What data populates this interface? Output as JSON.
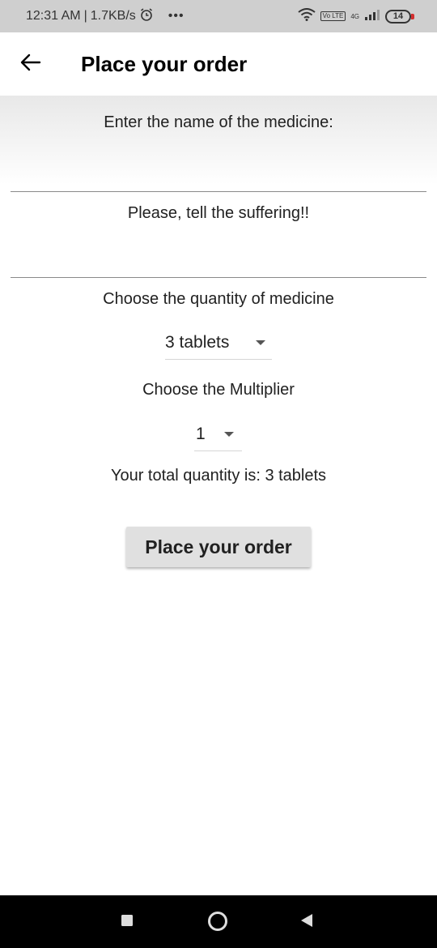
{
  "status_bar": {
    "time": "12:31 AM",
    "separator": "|",
    "speed": "1.7KB/s",
    "volte": "Vo LTE",
    "network": "4G",
    "battery": "14"
  },
  "app_bar": {
    "title": "Place your order"
  },
  "form": {
    "medicine_prompt": "Enter the name of the medicine:",
    "medicine_value": "",
    "suffering_prompt": "Please, tell the suffering!!",
    "suffering_value": "",
    "quantity_prompt": "Choose the quantity of medicine",
    "quantity_selected": "3 tablets",
    "multiplier_prompt": "Choose the Multiplier",
    "multiplier_selected": "1",
    "total_text": "Your total quantity is: 3 tablets",
    "submit_label": "Place your order"
  },
  "icons": {
    "back": "arrow-left-icon",
    "alarm": "alarm-icon",
    "wifi": "wifi-icon",
    "signal": "signal-icon",
    "battery": "battery-icon",
    "nav_recents": "square-icon",
    "nav_home": "circle-icon",
    "nav_back": "triangle-back-icon"
  },
  "colors": {
    "status_bar_bg": "#cfcfcf",
    "button_bg": "#e0e0e0",
    "nav_bar_bg": "#000000",
    "battery_low": "#d32f2f"
  }
}
